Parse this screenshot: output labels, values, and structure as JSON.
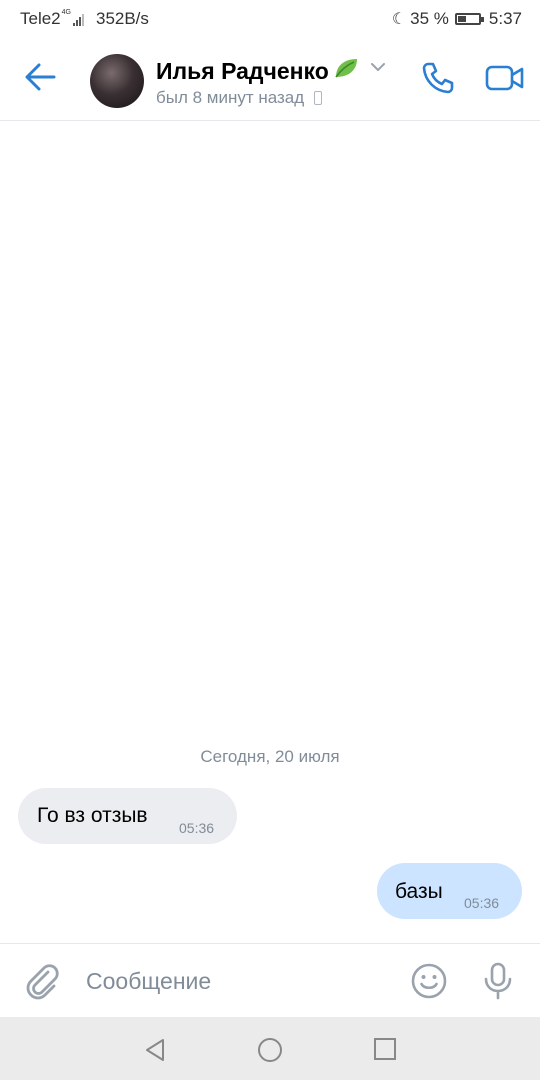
{
  "status_bar": {
    "carrier": "Tele2",
    "network": "4G",
    "speed": "352B/s",
    "battery": "35 %",
    "battery_level": 0.35,
    "time": "5:37"
  },
  "header": {
    "contact_name": "Илья Радченко",
    "last_seen": "был 8 минут назад",
    "icons": [
      "back-arrow-icon",
      "avatar",
      "leaf-icon",
      "chevron-down-icon",
      "call-icon",
      "video-call-icon"
    ]
  },
  "chat": {
    "date_separator": "Сегодня, 20 июля",
    "messages": [
      {
        "direction": "incoming",
        "text": "Го вз отзыв",
        "time": "05:36"
      },
      {
        "direction": "outgoing",
        "text": "базы",
        "time": "05:36"
      }
    ]
  },
  "composer": {
    "placeholder": "Сообщение",
    "icons": [
      "attach-icon",
      "emoji-icon",
      "microphone-icon"
    ]
  },
  "navbar": {
    "icons": [
      "nav-back-icon",
      "nav-home-icon",
      "nav-recents-icon"
    ]
  },
  "colors": {
    "accent": "#2a7fd3",
    "incoming_bubble": "#ebedf0",
    "outgoing_bubble": "#cce4ff",
    "secondary_text": "#818c99",
    "navbar_bg": "#ebebeb"
  }
}
